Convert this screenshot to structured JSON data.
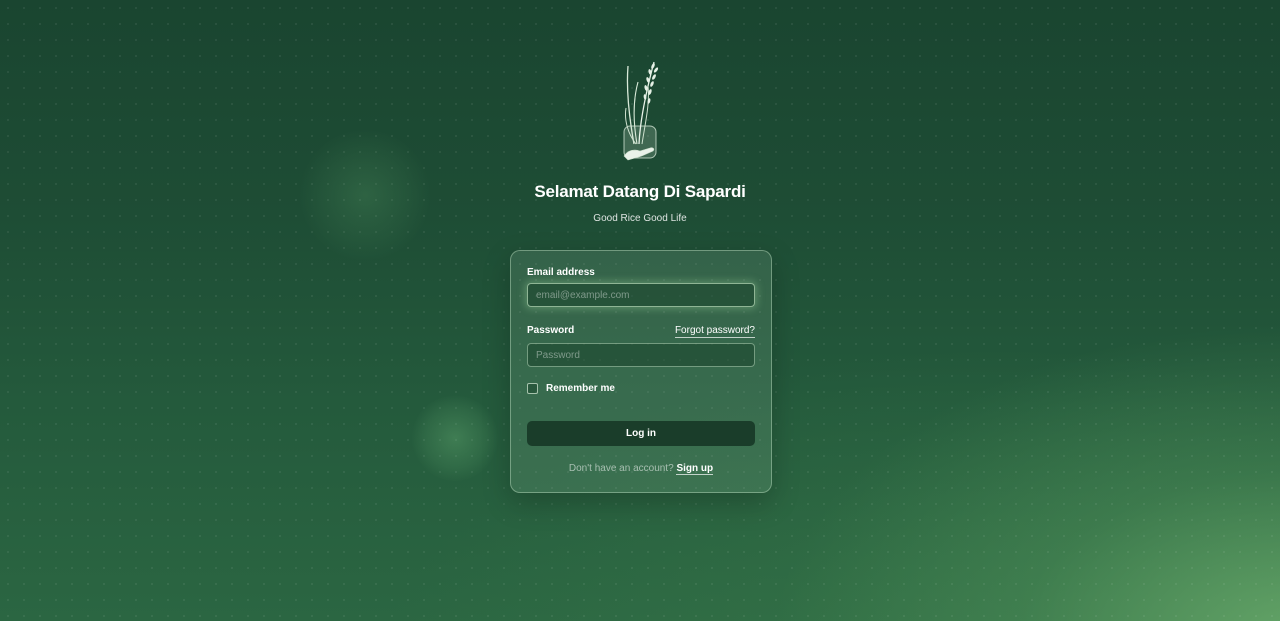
{
  "header": {
    "logo_icon": "rice-plant-in-hand-icon",
    "title": "Selamat Datang Di Sapardi",
    "subtitle": "Good Rice Good Life"
  },
  "login_form": {
    "email_label": "Email address",
    "email_placeholder": "email@example.com",
    "email_value": "",
    "password_label": "Password",
    "forgot_password_label": "Forgot password?",
    "password_placeholder": "Password",
    "password_value": "",
    "remember_label": "Remember me",
    "remember_checked": false,
    "login_button_label": "Log in",
    "signup_prompt": "Don't have an account?",
    "signup_link_label": "Sign up"
  },
  "colors": {
    "background_top": "#1a4530",
    "background_corner": "#6aaa6a",
    "button": "#1a3d2a"
  }
}
